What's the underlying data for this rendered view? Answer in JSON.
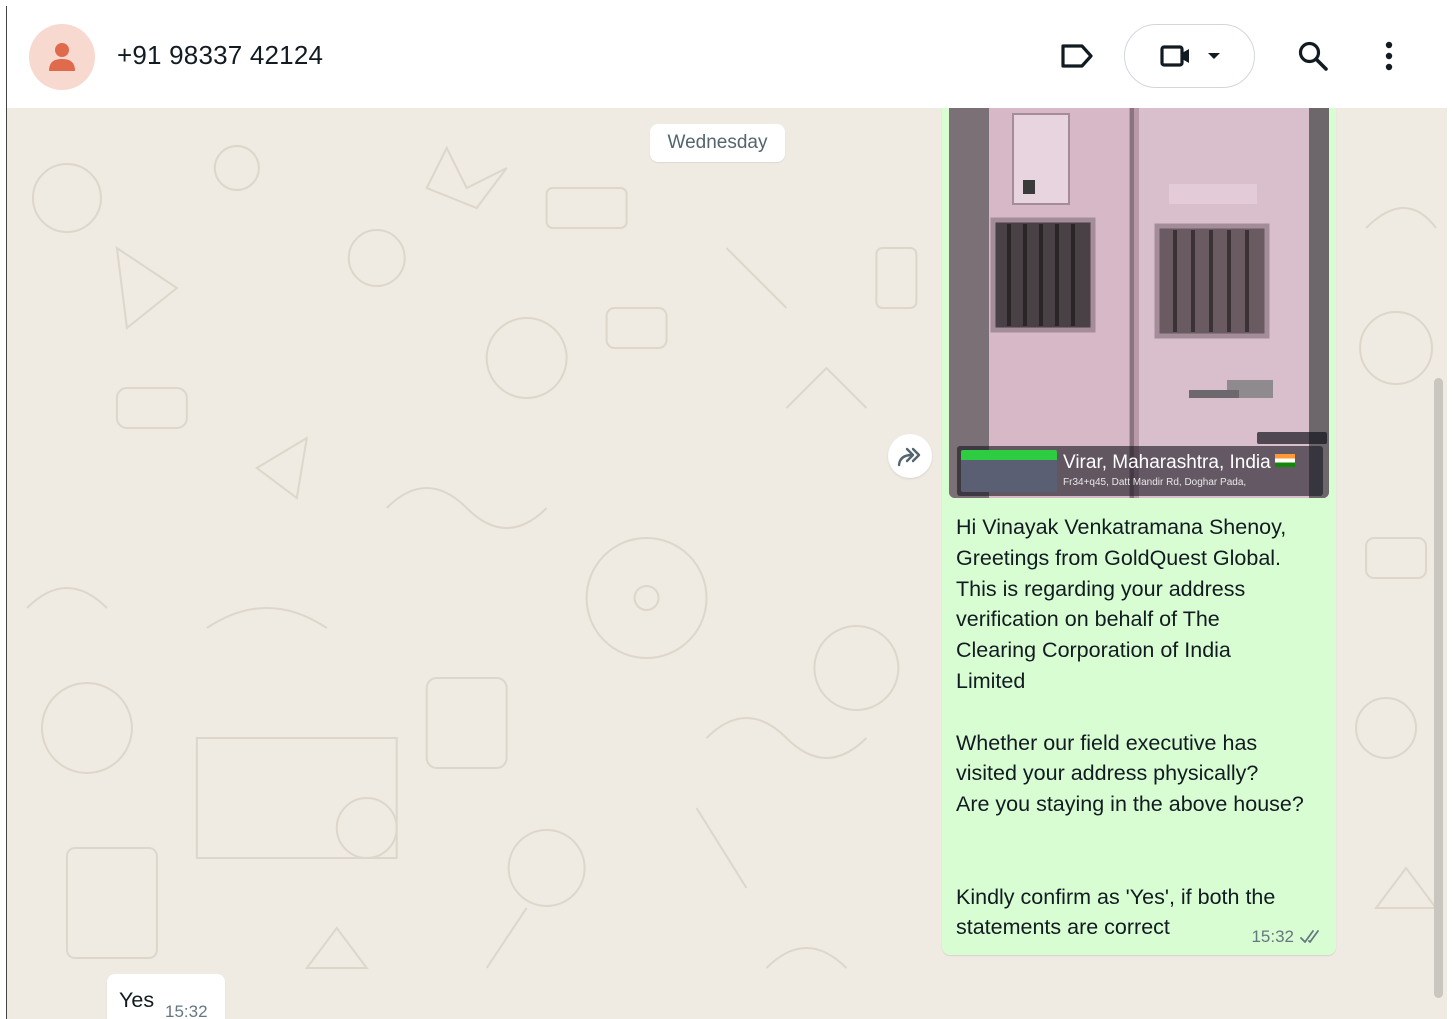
{
  "header": {
    "contact_name": "+91 98337 42124",
    "icons": [
      "person-icon",
      "label-icon",
      "video-call-icon",
      "chevron-down-icon",
      "search-icon",
      "more-options-icon"
    ]
  },
  "chat": {
    "date_separator": "Wednesday",
    "outgoing_message": {
      "photo": {
        "location_title": "Virar, Maharashtra, India",
        "location_address": "Fr34+q45, Datt Mandir Rd, Doghar Pada,"
      },
      "lines": [
        "Hi Vinayak Venkatramana Shenoy,",
        "Greetings from GoldQuest Global.",
        "This is regarding your address",
        "verification on behalf of The",
        "Clearing Corporation of India",
        "Limited",
        "",
        "Whether our field executive has",
        "visited your address physically?",
        "Are you staying in the above house?",
        "",
        "",
        "Kindly confirm as 'Yes', if both the",
        "statements are correct"
      ],
      "time": "15:32",
      "status": "read"
    },
    "incoming_message": {
      "text": "Yes",
      "time": "15:32"
    }
  },
  "colors": {
    "chat_background": "#efeae2",
    "outgoing_bubble": "#d9fdd3",
    "incoming_bubble": "#ffffff",
    "avatar_background": "#f7d9cf",
    "avatar_icon": "#e06a4c",
    "read_tick": "#667781"
  }
}
